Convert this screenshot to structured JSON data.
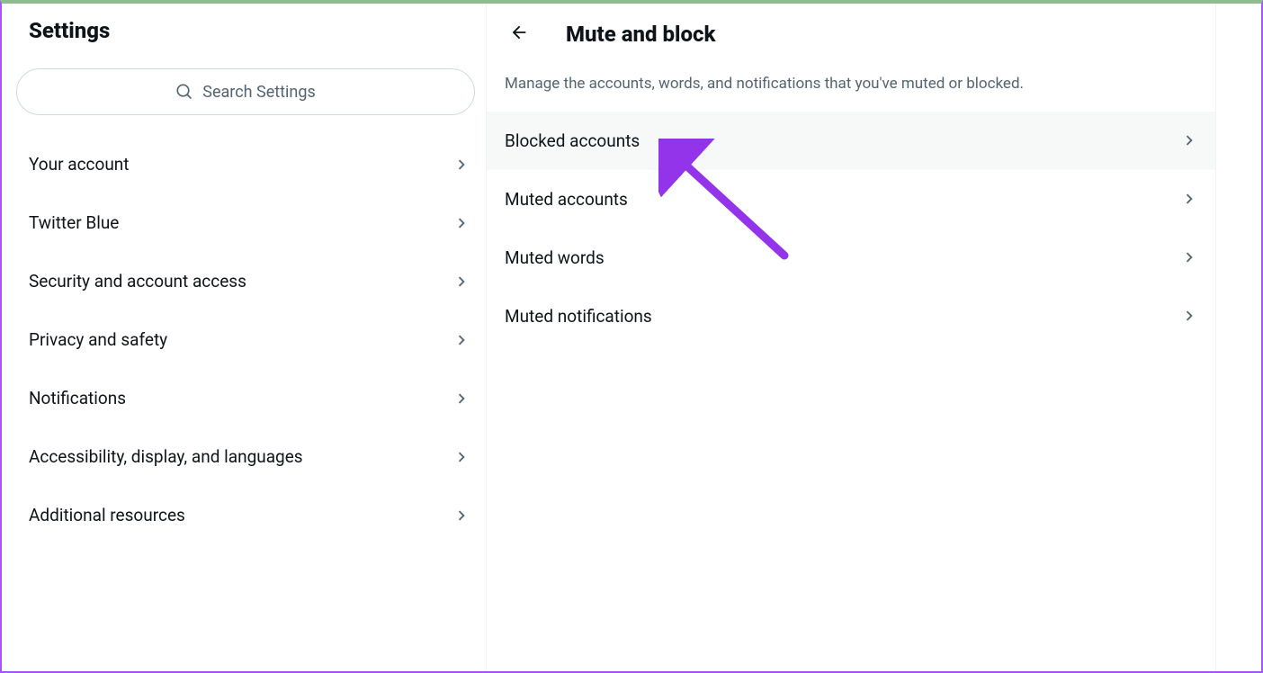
{
  "sidebar": {
    "title": "Settings",
    "search_placeholder": "Search Settings",
    "items": [
      {
        "label": "Your account"
      },
      {
        "label": "Twitter Blue"
      },
      {
        "label": "Security and account access"
      },
      {
        "label": "Privacy and safety"
      },
      {
        "label": "Notifications"
      },
      {
        "label": "Accessibility, display, and languages"
      },
      {
        "label": "Additional resources"
      }
    ]
  },
  "main": {
    "title": "Mute and block",
    "description": "Manage the accounts, words, and notifications that you've muted or blocked.",
    "items": [
      {
        "label": "Blocked accounts"
      },
      {
        "label": "Muted accounts"
      },
      {
        "label": "Muted words"
      },
      {
        "label": "Muted notifications"
      }
    ]
  }
}
